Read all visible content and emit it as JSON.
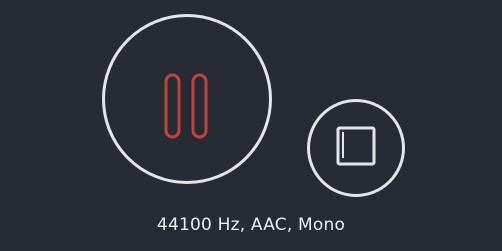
{
  "controls": {
    "pause": {
      "icon": "pause-icon",
      "icon_color": "#c0433e"
    },
    "stop": {
      "icon": "stop-icon",
      "icon_color": "#e3e5e9"
    }
  },
  "status": {
    "format_text": "44100 Hz, AAC, Mono"
  },
  "colors": {
    "background": "#272b34",
    "ring": "#e3e5e9",
    "accent": "#c0433e"
  }
}
